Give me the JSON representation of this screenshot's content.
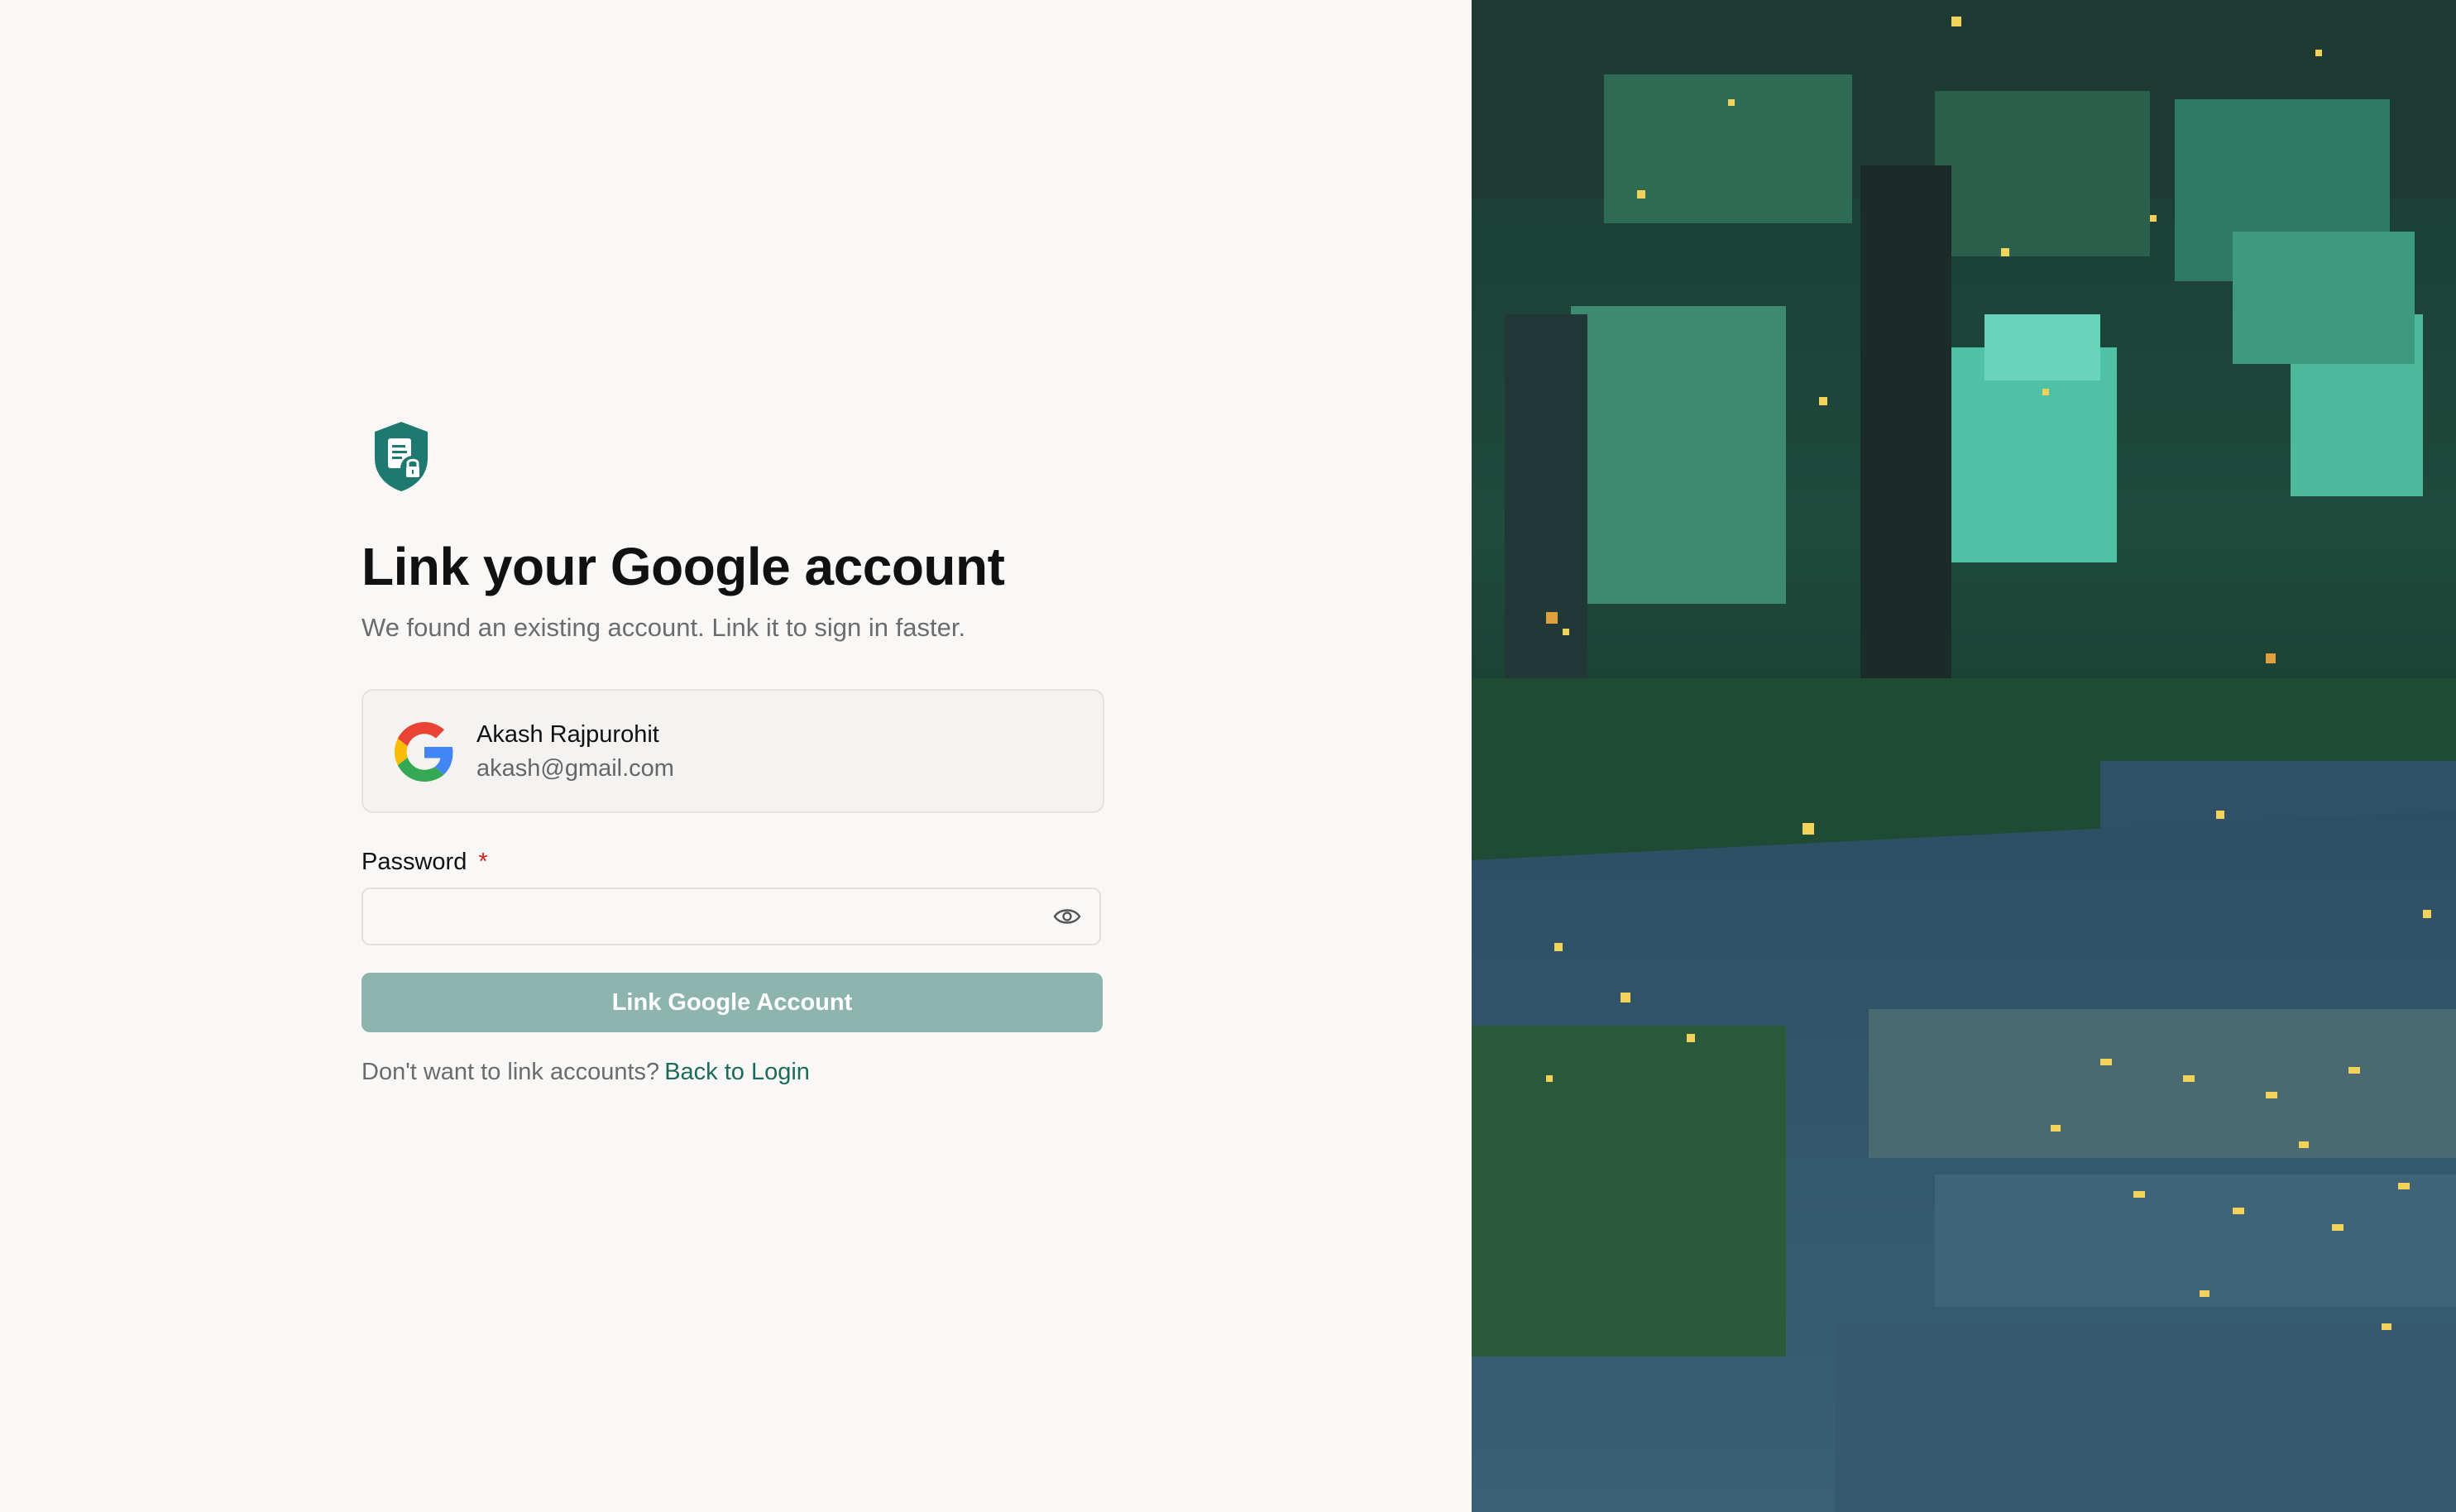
{
  "page": {
    "title": "Link your Google account",
    "subtitle": "We found an existing account. Link it to sign in faster."
  },
  "brand": {
    "logo_icon": "shield-document-lock-icon",
    "accent_color": "#1e7a70"
  },
  "account": {
    "provider_icon": "google-icon",
    "name": "Akash Rajpurohit",
    "email": "akash@gmail.com"
  },
  "password": {
    "label": "Password",
    "required_marker": "*",
    "value": "",
    "placeholder": "",
    "toggle_icon": "eye-icon"
  },
  "submit": {
    "label": "Link Google Account",
    "color": "#8eb5ad"
  },
  "footer": {
    "prompt": "Don't want to link accounts?",
    "link_label": "Back to Login",
    "link_color": "#1b6b5a"
  },
  "illustration": {
    "description_icon": "pixel-forest-path-image"
  }
}
